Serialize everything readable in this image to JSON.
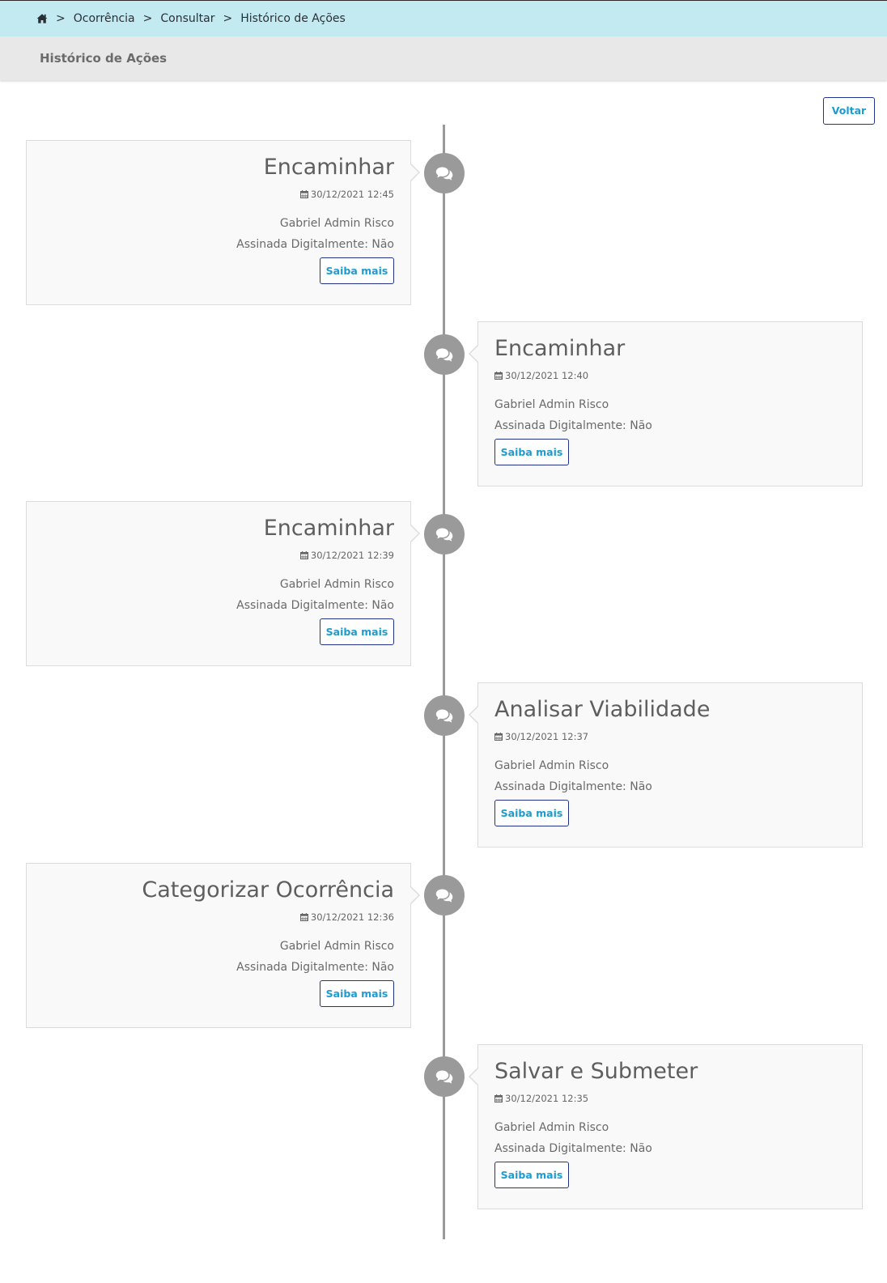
{
  "breadcrumb": {
    "home_icon": "home-icon",
    "separator": ">",
    "items": [
      "Ocorrência",
      "Consultar",
      "Histórico de Ações"
    ]
  },
  "page_title": "Histórico de Ações",
  "back_button": "Voltar",
  "timeline": {
    "event_icon": "comments-icon",
    "date_icon": "calendar-icon",
    "events": [
      {
        "title": "Encaminhar",
        "date": "30/12/2021 12:45",
        "user": "Gabriel Admin Risco",
        "signed": "Assinada Digitalmente: Não",
        "button": "Saiba mais",
        "side": "left"
      },
      {
        "title": "Encaminhar",
        "date": "30/12/2021 12:40",
        "user": "Gabriel Admin Risco",
        "signed": "Assinada Digitalmente: Não",
        "button": "Saiba mais",
        "side": "right"
      },
      {
        "title": "Encaminhar",
        "date": "30/12/2021 12:39",
        "user": "Gabriel Admin Risco",
        "signed": "Assinada Digitalmente: Não",
        "button": "Saiba mais",
        "side": "left"
      },
      {
        "title": "Analisar Viabilidade",
        "date": "30/12/2021 12:37",
        "user": "Gabriel Admin Risco",
        "signed": "Assinada Digitalmente: Não",
        "button": "Saiba mais",
        "side": "right"
      },
      {
        "title": "Categorizar Ocorrência",
        "date": "30/12/2021 12:36",
        "user": "Gabriel Admin Risco",
        "signed": "Assinada Digitalmente: Não",
        "button": "Saiba mais",
        "side": "left"
      },
      {
        "title": "Salvar e Submeter",
        "date": "30/12/2021 12:35",
        "user": "Gabriel Admin Risco",
        "signed": "Assinada Digitalmente: Não",
        "button": "Saiba mais",
        "side": "right"
      }
    ]
  }
}
